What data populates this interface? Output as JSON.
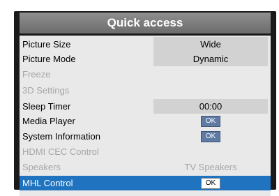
{
  "panel": {
    "title": "Quick access"
  },
  "menu": {
    "picture_size": {
      "label": "Picture Size",
      "value": "Wide"
    },
    "picture_mode": {
      "label": "Picture Mode",
      "value": "Dynamic"
    },
    "freeze": {
      "label": "Freeze"
    },
    "settings_3d": {
      "label": "3D Settings"
    },
    "sleep_timer": {
      "label": "Sleep Timer",
      "value": "00:00"
    },
    "media_player": {
      "label": "Media Player",
      "ok": "OK"
    },
    "system_information": {
      "label": "System Information",
      "ok": "OK"
    },
    "hdmi_cec_control": {
      "label": "HDMI CEC Control"
    },
    "speakers": {
      "label": "Speakers",
      "value": "TV Speakers"
    },
    "mhl_control": {
      "label": "MHL Control",
      "ok": "OK"
    }
  },
  "colors": {
    "highlight": "#1f73bf",
    "ok_button": "#5f7aa3",
    "disabled_text": "#a6a6a6"
  }
}
